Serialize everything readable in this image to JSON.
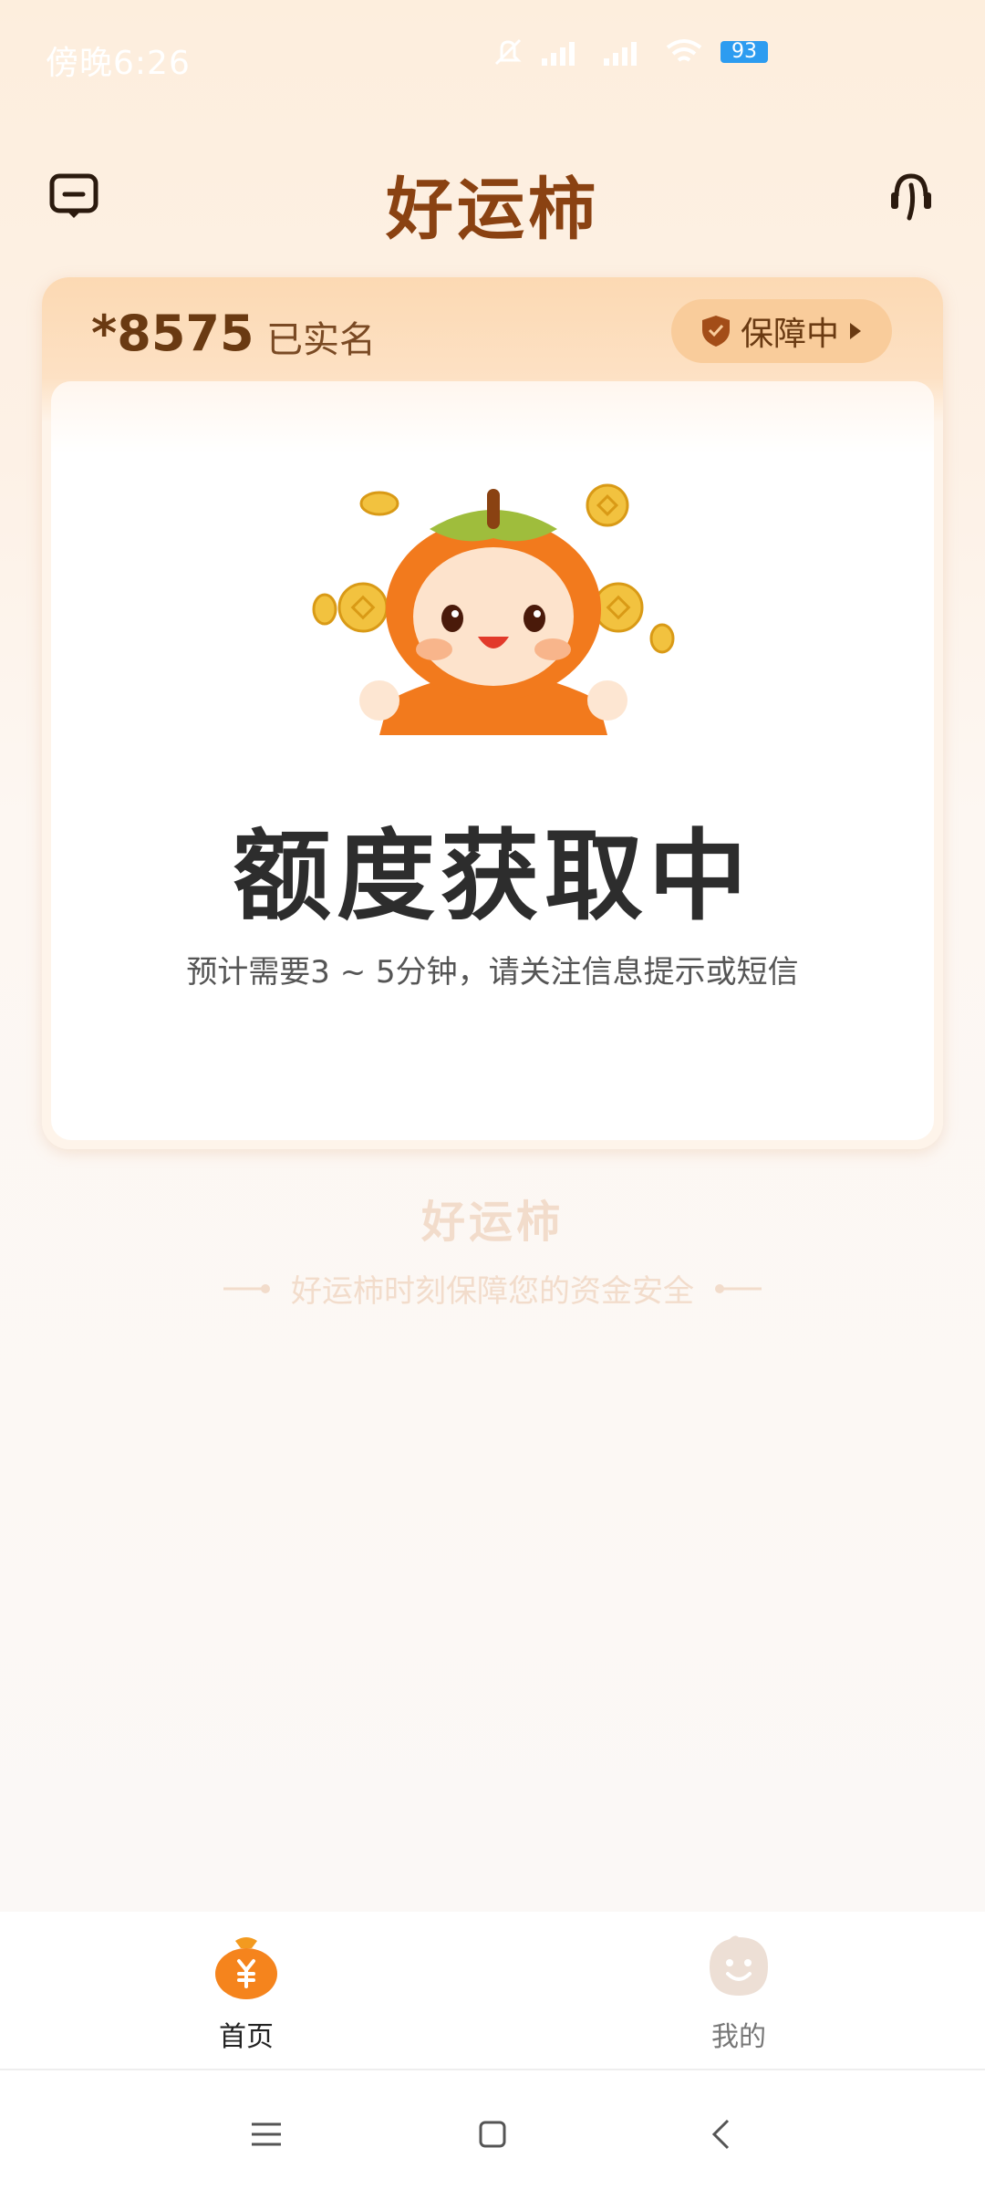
{
  "status_bar": {
    "time": "傍晚6:26",
    "battery": "93",
    "icons": [
      "mute-icon",
      "signal-icon",
      "signal-icon",
      "wifi-icon",
      "battery-icon"
    ]
  },
  "header": {
    "title": "好运柿",
    "left_icon": "message-icon",
    "right_icon": "customer-service-icon"
  },
  "account_card": {
    "account": "*8575",
    "verified": "已实名",
    "guard_label": "保障中",
    "status_title": "额度获取中",
    "status_desc": "预计需要3 ~ 5分钟，请关注信息提示或短信"
  },
  "brand": {
    "name": "好运柿",
    "slogan": "好运柿时刻保障您的资金安全"
  },
  "tabs": [
    {
      "label": "首页",
      "icon": "money-bag-icon",
      "active": true
    },
    {
      "label": "我的",
      "icon": "smiley-icon",
      "active": false
    }
  ],
  "colors": {
    "brand_brown": "#8a4212",
    "accent_orange": "#f58a1f",
    "battery_blue": "#2d9cf0"
  }
}
